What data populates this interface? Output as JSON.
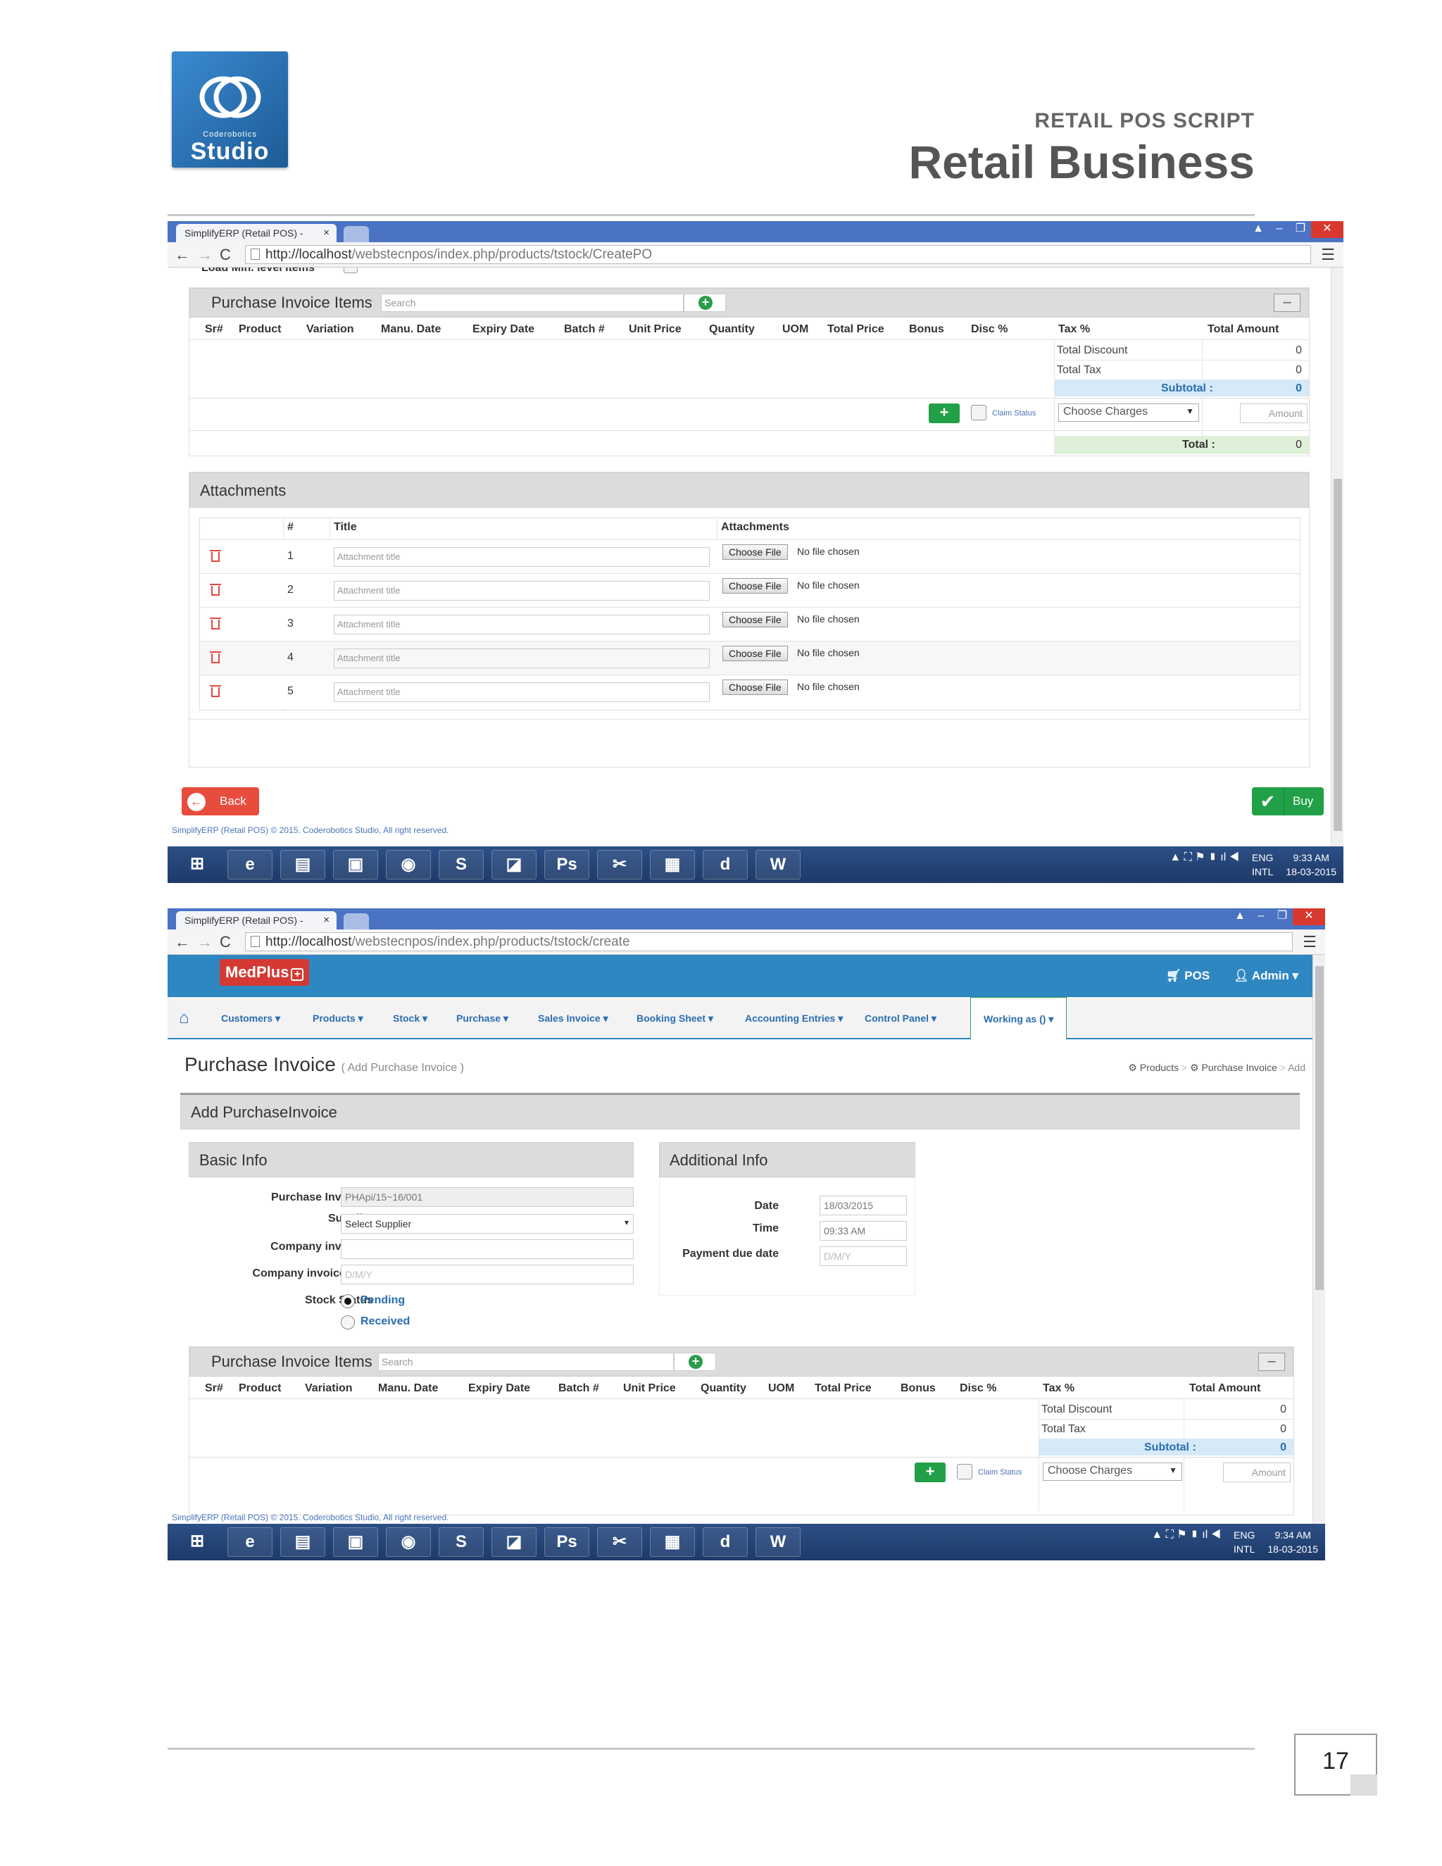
{
  "header": {
    "logo_sub": "Coderobotics",
    "logo_name": "Studio",
    "doc_subtitle": "RETAIL POS SCRIPT",
    "doc_title": "Retail Business"
  },
  "page_number": "17",
  "shot1": {
    "tab_title": "SimplifyERP (Retail POS) -",
    "url_host": "http://localhost",
    "url_path": "/webstecnpos/index.php/products/tstock/CreatePO",
    "clipped_label": "Load Min. level Items",
    "items_title": "Purchase Invoice Items",
    "search_placeholder": "Search",
    "columns": [
      "Sr#",
      "Product",
      "Variation",
      "Manu. Date",
      "Expiry Date",
      "Batch #",
      "Unit Price",
      "Quantity",
      "UOM",
      "Total Price",
      "Bonus",
      "Disc %",
      "Tax %",
      "Total Amount"
    ],
    "total_discount_label": "Total Discount",
    "total_discount_value": "0",
    "total_tax_label": "Total Tax",
    "total_tax_value": "0",
    "subtotal_label": "Subtotal :",
    "subtotal_value": "0",
    "claim_status": "Claim Status",
    "choose_charges": "Choose Charges",
    "amount_placeholder": "Amount",
    "total_label": "Total :",
    "total_value": "0",
    "attachments_title": "Attachments",
    "att_columns": [
      "#",
      "Title",
      "Attachments"
    ],
    "att_rows": [
      {
        "num": "1",
        "placeholder": "Attachment title",
        "btn": "Choose File",
        "status": "No file chosen"
      },
      {
        "num": "2",
        "placeholder": "Attachment title",
        "btn": "Choose File",
        "status": "No file chosen"
      },
      {
        "num": "3",
        "placeholder": "Attachment title",
        "btn": "Choose File",
        "status": "No file chosen"
      },
      {
        "num": "4",
        "placeholder": "Attachment title",
        "btn": "Choose File",
        "status": "No file chosen"
      },
      {
        "num": "5",
        "placeholder": "Attachment title",
        "btn": "Choose File",
        "status": "No file chosen"
      }
    ],
    "back_label": "Back",
    "buy_label": "Buy",
    "footer": "SimplifyERP (Retail POS) © 2015. Coderobotics Studio, All right reserved.",
    "tray_lang": "ENG",
    "tray_region": "INTL",
    "tray_time": "9:33 AM",
    "tray_date": "18-03-2015"
  },
  "shot2": {
    "tab_title": "SimplifyERP (Retail POS) -",
    "url_host": "http://localhost",
    "url_path": "/webstecnpos/index.php/products/tstock/create",
    "brand": "MedPlus",
    "pos_label": "POS",
    "admin_label": "Admin",
    "nav": [
      "Customers",
      "Products",
      "Stock",
      "Purchase",
      "Sales Invoice",
      "Booking Sheet",
      "Accounting Entries",
      "Control Panel"
    ],
    "working_as": "Working as ()",
    "page_title": "Purchase Invoice",
    "page_subtitle": "( Add Purchase Invoice )",
    "breadcrumb": [
      "Products",
      "Purchase Invoice",
      "Add"
    ],
    "section_title": "Add PurchaseInvoice",
    "basic_info_title": "Basic Info",
    "additional_info_title": "Additional Info",
    "fields": {
      "invoice_no_label": "Purchase Invoice #",
      "invoice_no_value": "PHApi/15~16/001",
      "supplier_label": "Supplier",
      "supplier_value": "Select Supplier",
      "company_invoice_label": "Company invoice #",
      "company_invoice_date_label": "Company invoice Date",
      "company_invoice_date_placeholder": "D/M/Y",
      "stock_status_label": "Stock Status",
      "status_pending": "Pending",
      "status_received": "Received",
      "date_label": "Date",
      "date_value": "18/03/2015",
      "time_label": "Time",
      "time_value": "09:33 AM",
      "payment_due_label": "Payment due date",
      "payment_due_placeholder": "D/M/Y"
    },
    "items_title": "Purchase Invoice Items",
    "search_placeholder": "Search",
    "columns": [
      "Sr#",
      "Product",
      "Variation",
      "Manu. Date",
      "Expiry Date",
      "Batch #",
      "Unit Price",
      "Quantity",
      "UOM",
      "Total Price",
      "Bonus",
      "Disc %",
      "Tax %",
      "Total Amount"
    ],
    "total_discount_label": "Total Discount",
    "total_discount_value": "0",
    "total_tax_label": "Total Tax",
    "total_tax_value": "0",
    "subtotal_label": "Subtotal :",
    "subtotal_value": "0",
    "claim_status": "Claim Status",
    "choose_charges": "Choose Charges",
    "amount_placeholder": "Amount",
    "footer": "SimplifyERP (Retail POS) © 2015. Coderobotics Studio, All right reserved.",
    "tray_lang": "ENG",
    "tray_region": "INTL",
    "tray_time": "9:34 AM",
    "tray_date": "18-03-2015"
  },
  "taskbar_apps": [
    "windows-start",
    "internet-explorer",
    "file-explorer",
    "store",
    "chrome",
    "skype",
    "notes",
    "photoshop",
    "tools",
    "network",
    "dreamweaver",
    "word"
  ]
}
